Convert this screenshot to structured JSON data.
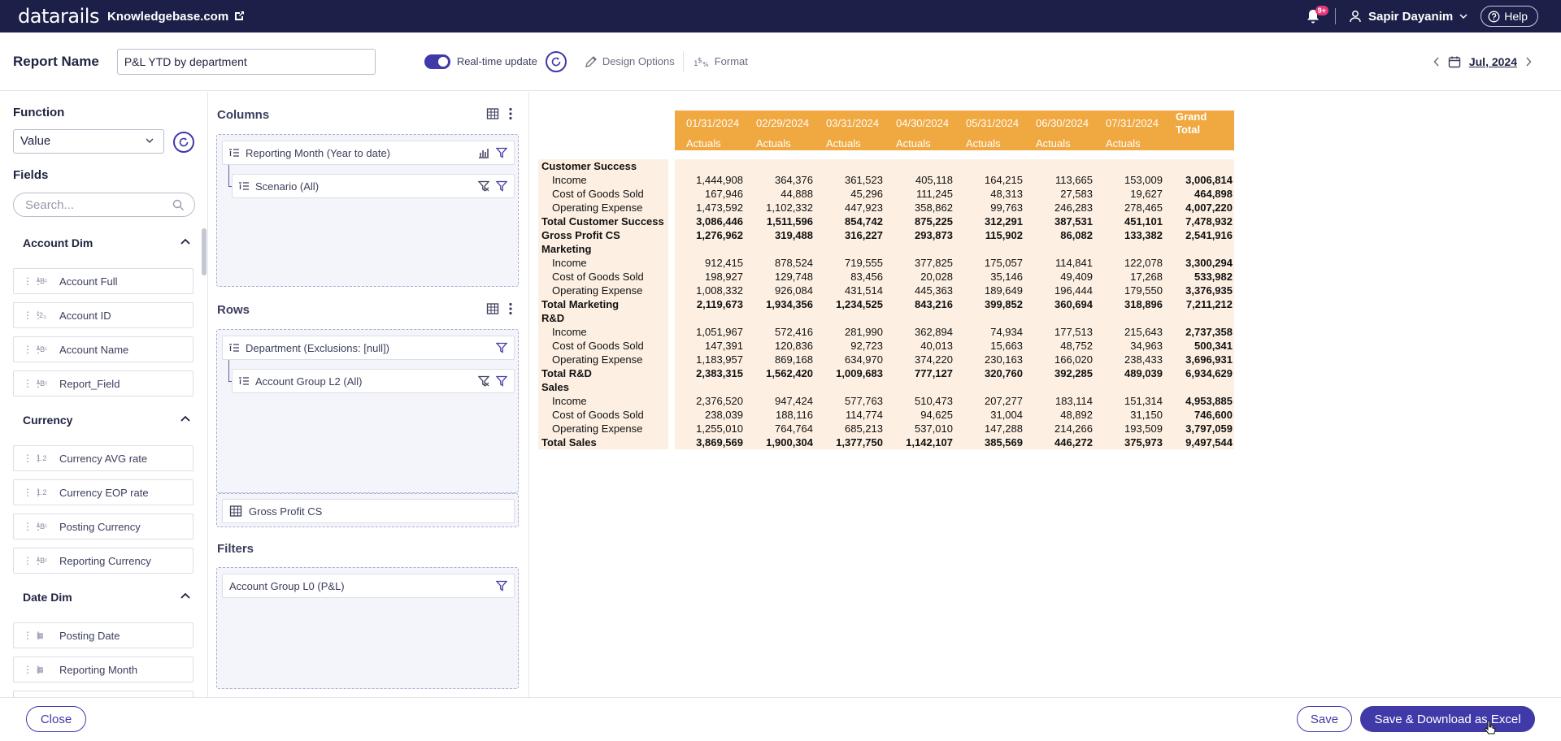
{
  "topbar": {
    "logo": "datarails",
    "company": "Knowledgebase.com",
    "notification_badge": "9+",
    "user_name": "Sapir Dayanim",
    "help_label": "Help",
    "bg_color": "#1c2048"
  },
  "header": {
    "report_name_label": "Report Name",
    "report_name_value": "P&L YTD by department",
    "realtime_label": "Real-time update",
    "realtime_on": true,
    "design_options_label": "Design Options",
    "format_label": "Format",
    "period": "Jul, 2024"
  },
  "left": {
    "function_label": "Function",
    "function_value": "Value",
    "fields_label": "Fields",
    "search_placeholder": "Search...",
    "groups": [
      {
        "title": "Account Dim",
        "fields": [
          {
            "type": "ABC",
            "name": "Account Full"
          },
          {
            "type": "123",
            "name": "Account ID"
          },
          {
            "type": "ABC",
            "name": "Account Name"
          },
          {
            "type": "ABC",
            "name": "Report_Field"
          }
        ]
      },
      {
        "title": "Currency",
        "fields": [
          {
            "type": "1.2",
            "name": "Currency AVG rate"
          },
          {
            "type": "1.2",
            "name": "Currency EOP rate"
          },
          {
            "type": "ABC",
            "name": "Posting Currency"
          },
          {
            "type": "ABC",
            "name": "Reporting Currency"
          }
        ]
      },
      {
        "title": "Date Dim",
        "fields": [
          {
            "type": "date",
            "name": "Posting Date"
          },
          {
            "type": "date",
            "name": "Reporting Month"
          }
        ]
      }
    ]
  },
  "mid": {
    "columns_label": "Columns",
    "columns": [
      "Reporting Month (Year to date)",
      "Scenario (All)"
    ],
    "rows_label": "Rows",
    "rows": [
      "Department (Exclusions: [null])",
      "Account Group L2 (All)"
    ],
    "values_item": "Gross Profit CS",
    "filters_label": "Filters",
    "filters": [
      "Account Group L0 (P&L)"
    ]
  },
  "report": {
    "header_dates": [
      "01/31/2024",
      "02/29/2024",
      "03/31/2024",
      "04/30/2024",
      "05/31/2024",
      "06/30/2024",
      "07/31/2024"
    ],
    "header_scenario": "Actuals",
    "grand_total_label": "Grand Total",
    "header_color": "#f0a840",
    "row_bg_color": "#fdf0e3",
    "rows": [
      {
        "label": "Customer Success",
        "kind": "group",
        "values": [
          "",
          "",
          "",
          "",
          "",
          "",
          "",
          ""
        ]
      },
      {
        "label": "Income",
        "kind": "child",
        "values": [
          "1,444,908",
          "364,376",
          "361,523",
          "405,118",
          "164,215",
          "113,665",
          "153,009",
          "3,006,814"
        ]
      },
      {
        "label": "Cost of Goods Sold",
        "kind": "child",
        "values": [
          "167,946",
          "44,888",
          "45,296",
          "111,245",
          "48,313",
          "27,583",
          "19,627",
          "464,898"
        ]
      },
      {
        "label": "Operating Expense",
        "kind": "child",
        "values": [
          "1,473,592",
          "1,102,332",
          "447,923",
          "358,862",
          "99,763",
          "246,283",
          "278,465",
          "4,007,220"
        ]
      },
      {
        "label": "Total Customer Success",
        "kind": "total",
        "values": [
          "3,086,446",
          "1,511,596",
          "854,742",
          "875,225",
          "312,291",
          "387,531",
          "451,101",
          "7,478,932"
        ]
      },
      {
        "label": "Gross Profit CS",
        "kind": "total",
        "values": [
          "1,276,962",
          "319,488",
          "316,227",
          "293,873",
          "115,902",
          "86,082",
          "133,382",
          "2,541,916"
        ]
      },
      {
        "label": "Marketing",
        "kind": "group",
        "values": [
          "",
          "",
          "",
          "",
          "",
          "",
          "",
          ""
        ]
      },
      {
        "label": "Income",
        "kind": "child",
        "values": [
          "912,415",
          "878,524",
          "719,555",
          "377,825",
          "175,057",
          "114,841",
          "122,078",
          "3,300,294"
        ]
      },
      {
        "label": "Cost of Goods Sold",
        "kind": "child",
        "values": [
          "198,927",
          "129,748",
          "83,456",
          "20,028",
          "35,146",
          "49,409",
          "17,268",
          "533,982"
        ]
      },
      {
        "label": "Operating Expense",
        "kind": "child",
        "values": [
          "1,008,332",
          "926,084",
          "431,514",
          "445,363",
          "189,649",
          "196,444",
          "179,550",
          "3,376,935"
        ]
      },
      {
        "label": "Total Marketing",
        "kind": "total",
        "values": [
          "2,119,673",
          "1,934,356",
          "1,234,525",
          "843,216",
          "399,852",
          "360,694",
          "318,896",
          "7,211,212"
        ]
      },
      {
        "label": "R&D",
        "kind": "group",
        "values": [
          "",
          "",
          "",
          "",
          "",
          "",
          "",
          ""
        ]
      },
      {
        "label": "Income",
        "kind": "child",
        "values": [
          "1,051,967",
          "572,416",
          "281,990",
          "362,894",
          "74,934",
          "177,513",
          "215,643",
          "2,737,358"
        ]
      },
      {
        "label": "Cost of Goods Sold",
        "kind": "child",
        "values": [
          "147,391",
          "120,836",
          "92,723",
          "40,013",
          "15,663",
          "48,752",
          "34,963",
          "500,341"
        ]
      },
      {
        "label": "Operating Expense",
        "kind": "child",
        "values": [
          "1,183,957",
          "869,168",
          "634,970",
          "374,220",
          "230,163",
          "166,020",
          "238,433",
          "3,696,931"
        ]
      },
      {
        "label": "Total R&D",
        "kind": "total",
        "values": [
          "2,383,315",
          "1,562,420",
          "1,009,683",
          "777,127",
          "320,760",
          "392,285",
          "489,039",
          "6,934,629"
        ]
      },
      {
        "label": "Sales",
        "kind": "group",
        "values": [
          "",
          "",
          "",
          "",
          "",
          "",
          "",
          ""
        ]
      },
      {
        "label": "Income",
        "kind": "child",
        "values": [
          "2,376,520",
          "947,424",
          "577,763",
          "510,473",
          "207,277",
          "183,114",
          "151,314",
          "4,953,885"
        ]
      },
      {
        "label": "Cost of Goods Sold",
        "kind": "child",
        "values": [
          "238,039",
          "188,116",
          "114,774",
          "94,625",
          "31,004",
          "48,892",
          "31,150",
          "746,600"
        ]
      },
      {
        "label": "Operating Expense",
        "kind": "child",
        "values": [
          "1,255,010",
          "764,764",
          "685,213",
          "537,010",
          "147,288",
          "214,266",
          "193,509",
          "3,797,059"
        ]
      },
      {
        "label": "Total Sales",
        "kind": "total",
        "values": [
          "3,869,569",
          "1,900,304",
          "1,377,750",
          "1,142,107",
          "385,569",
          "446,272",
          "375,973",
          "9,497,544"
        ]
      }
    ]
  },
  "footer": {
    "close_label": "Close",
    "save_label": "Save",
    "save_download_label": "Save & Download as Excel",
    "accent_color": "#3f3aa8"
  }
}
